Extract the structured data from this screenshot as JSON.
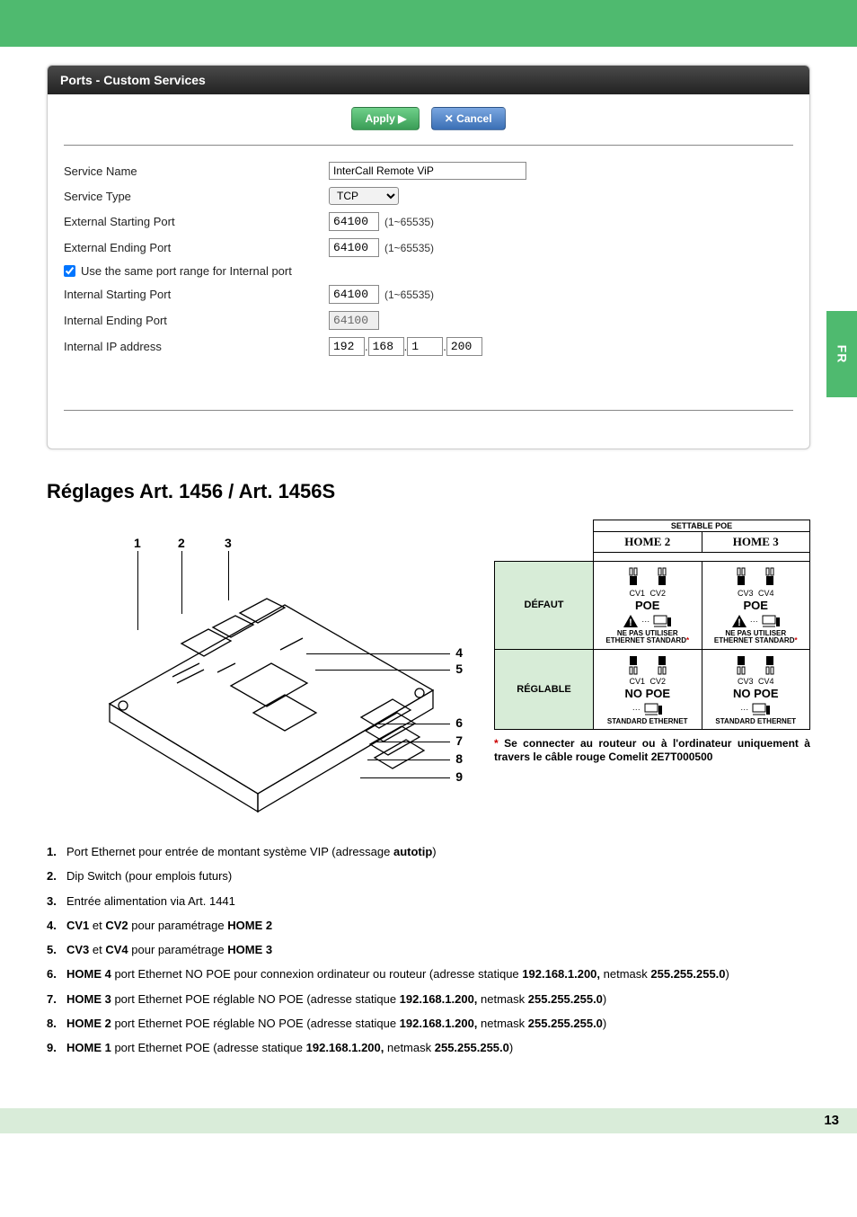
{
  "side_tab": "FR",
  "page_number": "13",
  "router_panel": {
    "title": "Ports - Custom Services",
    "apply": "Apply ▶",
    "cancel": "✕ Cancel",
    "rows": {
      "service_name_label": "Service Name",
      "service_name_value": "InterCall Remote ViP",
      "service_type_label": "Service Type",
      "service_type_value": "TCP",
      "ext_start_label": "External Starting Port",
      "ext_start_value": "64100",
      "ext_end_label": "External Ending Port",
      "ext_end_value": "64100",
      "same_range": "Use the same port range for Internal port",
      "int_start_label": "Internal Starting Port",
      "int_start_value": "64100",
      "int_end_label": "Internal Ending Port",
      "int_end_value": "64100",
      "ip_label": "Internal IP address",
      "ip": [
        "192",
        "168",
        "1",
        "200"
      ],
      "port_hint": "(1~65535)"
    }
  },
  "section_title": "Réglages Art. 1456 / Art. 1456S",
  "diagram_callouts": {
    "c1": "1",
    "c2": "2",
    "c3": "3",
    "c4": "4",
    "c5": "5",
    "c6": "6",
    "c7": "7",
    "c8": "8",
    "c9": "9"
  },
  "poe_table": {
    "top": "SETTABLE POE",
    "home2": "HOME 2",
    "home3": "HOME 3",
    "row_default": "DÉFAUT",
    "row_settable": "RÉGLABLE",
    "cv1": "CV1",
    "cv2": "CV2",
    "cv3": "CV3",
    "cv4": "CV4",
    "poe": "POE",
    "nopoe": "NO POE",
    "warn_note": "NE PAS UTILISER ETHERNET STANDARD",
    "std_note": "STANDARD ETHERNET"
  },
  "footnote_prefix": "* ",
  "footnote": "Se connecter au routeur ou à l'ordinateur uniquement à travers le câble rouge Comelit 2E7T000500",
  "legend": [
    {
      "n": "1.",
      "html": "Port Ethernet pour entrée de montant système VIP (adressage <b>autotip</b>)"
    },
    {
      "n": "2.",
      "html": "Dip Switch (pour emplois futurs)"
    },
    {
      "n": "3.",
      "html": "Entrée alimentation via Art. 1441"
    },
    {
      "n": "4.",
      "html": "<b>CV1</b> et <b>CV2</b> pour paramétrage <b>HOME 2</b>"
    },
    {
      "n": "5.",
      "html": "<b>CV3</b> et <b>CV4</b> pour paramétrage <b>HOME 3</b>"
    },
    {
      "n": "6.",
      "html": "<b>HOME 4</b> port Ethernet NO POE pour connexion ordinateur ou routeur (adresse statique <b>192.168.1.200,</b> netmask <b>255.255.255.0</b>)"
    },
    {
      "n": "7.",
      "html": "<b>HOME 3</b> port Ethernet POE réglable NO POE (adresse statique <b>192.168.1.200,</b> netmask <b>255.255.255.0</b>)"
    },
    {
      "n": "8.",
      "html": "<b>HOME 2</b> port Ethernet POE réglable NO POE (adresse statique <b>192.168.1.200,</b> netmask <b>255.255.255.0</b>)"
    },
    {
      "n": "9.",
      "html": "<b>HOME 1</b> port Ethernet POE (adresse statique <b>192.168.1.200,</b> netmask <b>255.255.255.0</b>)"
    }
  ]
}
